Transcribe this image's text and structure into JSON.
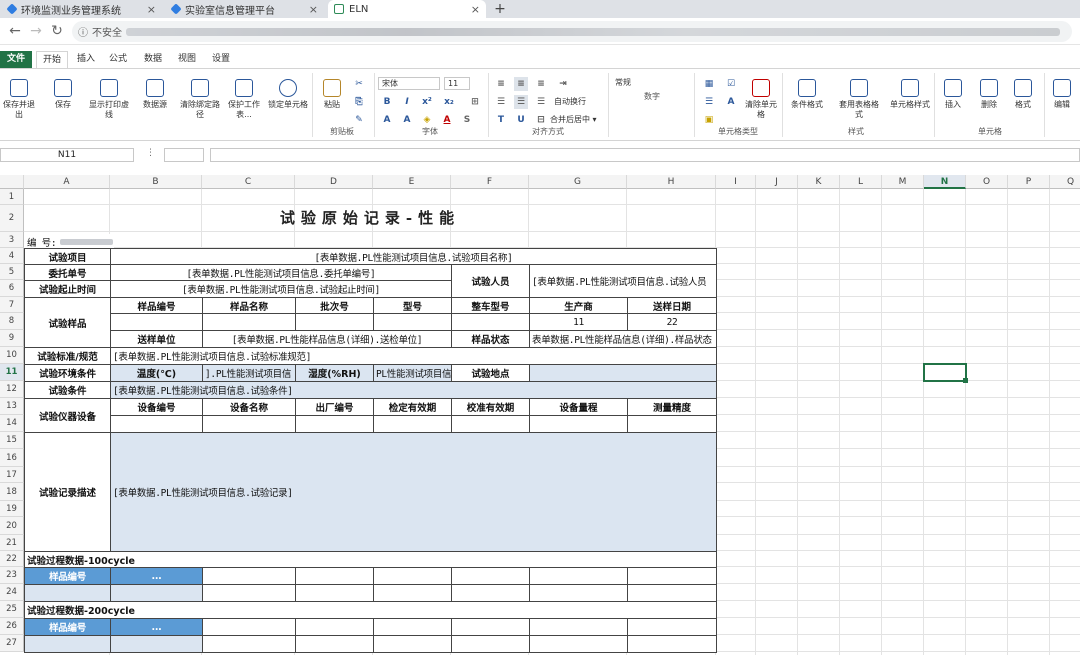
{
  "browser": {
    "tabs": [
      {
        "title": "环境监测业务管理系统",
        "active": false
      },
      {
        "title": "实验室信息管理平台",
        "active": false
      },
      {
        "title": "ELN",
        "active": true
      }
    ],
    "new_tab": "+",
    "insecure_label": "不安全"
  },
  "ribbon": {
    "tabs": [
      "文件",
      "开始",
      "插入",
      "公式",
      "数据",
      "视图",
      "设置"
    ],
    "buttons": {
      "save_exit": "保存并退出",
      "save": "保存",
      "print_preview": "显示打印虚线",
      "datasource": "数据源",
      "clear_binding": "清除绑定路径",
      "protect_sheet": "保护工作表...",
      "lock_cell": "锁定单元格",
      "paste": "粘贴",
      "clipboard": "剪贴板",
      "font_name": "宋体",
      "font_size": "11",
      "font_group": "字体",
      "wrap": "自动换行",
      "merge": "合并后居中",
      "align_group": "对齐方式",
      "number_format": "常规",
      "number_group": "数字",
      "clear_celltype": "清除单元格",
      "celltype_group": "单元格类型",
      "cond_format": "条件格式",
      "table_format": "套用表格格式",
      "cell_style": "单元格样式",
      "style_group": "样式",
      "insert": "插入",
      "delete": "删除",
      "format": "格式",
      "cells_group": "单元格",
      "edit": "编辑"
    }
  },
  "formula_bar": {
    "name_box": "N11",
    "dots": "⋮"
  },
  "sheet": {
    "columns": [
      "A",
      "B",
      "C",
      "D",
      "E",
      "F",
      "G",
      "H",
      "I",
      "J",
      "K",
      "L",
      "M",
      "N",
      "O",
      "P",
      "Q"
    ],
    "selected_column": "N",
    "selected_row": 11,
    "rows": [
      "1",
      "2",
      "3",
      "4",
      "5",
      "6",
      "7",
      "8",
      "9",
      "10",
      "11",
      "12",
      "13",
      "14",
      "15",
      "16",
      "17",
      "18",
      "19",
      "20",
      "21",
      "22",
      "23",
      "24",
      "25",
      "26",
      "27"
    ],
    "title": "试验原始记录-性能",
    "code_label": "编 号:",
    "cells": {
      "item_label": "试验项目",
      "item_val": "[表单数据.PL性能测试项目信息.试验项目名称]",
      "entrust_label": "委托单号",
      "entrust_val": "[表单数据.PL性能测试项目信息.委托单编号]",
      "tester_label": "试验人员",
      "tester_val": "[表单数据.PL性能测试项目信息.试验人员",
      "period_label": "试验起止时间",
      "period_val": "[表单数据.PL性能测试项目信息.试验起止时间]",
      "sample_label": "试验样品",
      "s_no": "样品编号",
      "s_name": "样品名称",
      "s_batch": "批次号",
      "s_model": "型号",
      "s_vehicle": "整车型号",
      "s_maker": "生产商",
      "s_date": "送样日期",
      "s_maker_val": "11",
      "s_date_val": "22",
      "send_unit": "送样单位",
      "send_unit_val": "[表单数据.PL性能样品信息(详细).送检单位]",
      "state_label": "样品状态",
      "state_val": "表单数据.PL性能样品信息(详细).样品状态",
      "standard_label": "试验标准/规范",
      "standard_val": "[表单数据.PL性能测试项目信息.试验标准规范]",
      "env_label": "试验环境条件",
      "temp_label": "温度(℃)",
      "temp_val": "].PL性能测试项目信",
      "hum_label": "湿度(%RH)",
      "hum_val": "PL性能测试项目信",
      "place_label": "试验地点",
      "cond_label": "试验条件",
      "cond_val": "[表单数据.PL性能测试项目信息.试验条件]",
      "instr_label": "试验仪器设备",
      "i_no": "设备编号",
      "i_name": "设备名称",
      "i_factory": "出厂编号",
      "i_valid": "检定有效期",
      "i_calib": "校准有效期",
      "i_range": "设备量程",
      "i_prec": "测量精度",
      "record_label": "试验记录描述",
      "record_val": "[表单数据.PL性能测试项目信息.试验记录]",
      "proc100": "试验过程数据-100cycle",
      "proc200": "试验过程数据-200cycle",
      "sample_no": "样品编号",
      "ellipsis": "..."
    }
  }
}
